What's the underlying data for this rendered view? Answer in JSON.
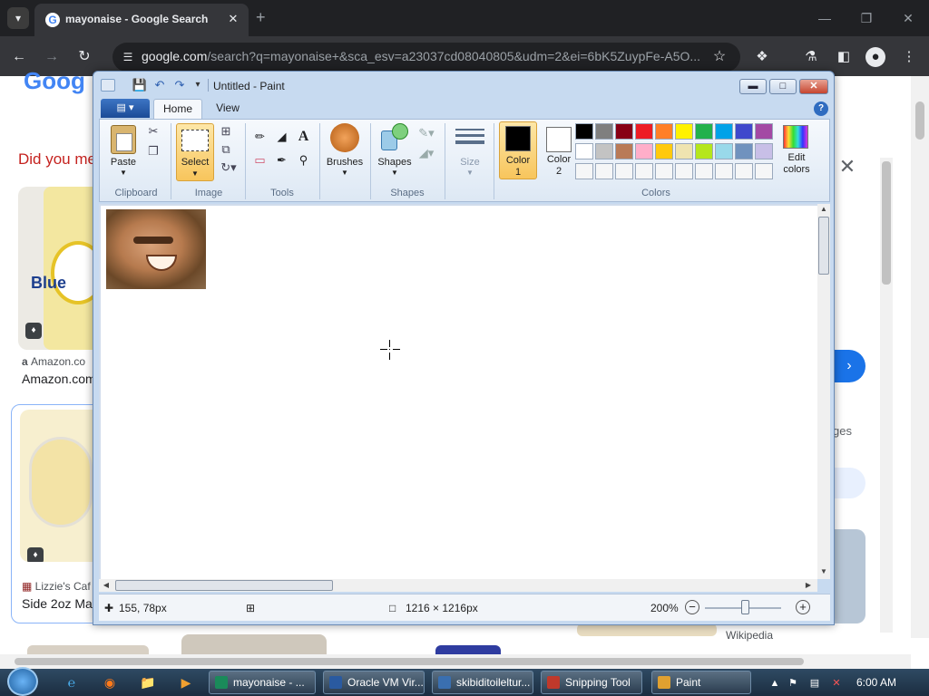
{
  "browser": {
    "tab_title": "mayonaise - Google Search",
    "tab_favicon": "G",
    "url_host": "google.com",
    "url_path": "/search?q=mayonaise+&sca_esv=a23037cd08040805&udm=2&ei=6bK5ZuypFe-A5O..."
  },
  "google": {
    "logo_text": "Goog",
    "did_you_mean": "Did you me",
    "results": [
      {
        "source": "Amazon.co",
        "title": "Amazon.com",
        "image_text": "Blue"
      },
      {
        "source": "Lizzie's Caf",
        "title": "Side 2oz Ma"
      }
    ],
    "images_label": "ges",
    "wiki_source": "Wikipedia"
  },
  "paint": {
    "window_title": "Untitled - Paint",
    "tabs": {
      "home": "Home",
      "view": "View"
    },
    "groups": {
      "clipboard": "Clipboard",
      "image": "Image",
      "tools": "Tools",
      "shapes": "Shapes",
      "colors": "Colors"
    },
    "buttons": {
      "paste": "Paste",
      "select": "Select",
      "brushes": "Brushes",
      "shapes": "Shapes",
      "size": "Size",
      "color1_line1": "Color",
      "color1_line2": "1",
      "color2_line1": "Color",
      "color2_line2": "2",
      "edit_colors_line1": "Edit",
      "edit_colors_line2": "colors"
    },
    "color1": "#000000",
    "color2": "#ffffff",
    "palette": [
      "#000000",
      "#7f7f7f",
      "#880015",
      "#ed1c24",
      "#ff7f27",
      "#fff200",
      "#22b14c",
      "#00a2e8",
      "#3f48cc",
      "#a349a4",
      "#ffffff",
      "#c3c3c3",
      "#b97a57",
      "#ffaec9",
      "#ffc90e",
      "#efe4b0",
      "#b5e61d",
      "#99d9ea",
      "#7092be",
      "#c8bfe7",
      "#f5f6f7",
      "#f5f6f7",
      "#f5f6f7",
      "#f5f6f7",
      "#f5f6f7",
      "#f5f6f7",
      "#f5f6f7",
      "#f5f6f7",
      "#f5f6f7",
      "#f5f6f7"
    ],
    "status": {
      "cursor_pos": "155, 78px",
      "canvas_size": "1216 × 1216px",
      "zoom": "200%"
    }
  },
  "taskbar": {
    "items": [
      {
        "label": "mayonaise - ...",
        "color": "#1a8a5a"
      },
      {
        "label": "Oracle VM Vir...",
        "color": "#2a5aa0"
      },
      {
        "label": "skibiditoileltur...",
        "color": "#3a6fb0"
      },
      {
        "label": "Snipping Tool",
        "color": "#c0392b"
      },
      {
        "label": "Paint",
        "color": "#e0a030"
      }
    ],
    "clock": "6:00 AM"
  }
}
